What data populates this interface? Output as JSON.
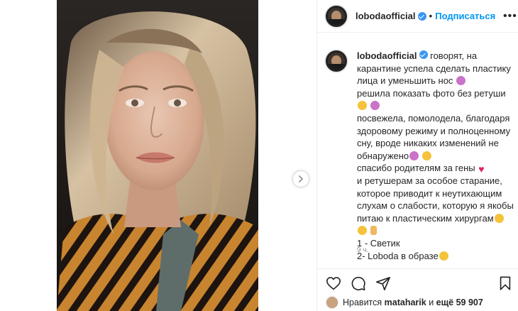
{
  "header": {
    "username": "lobodaofficial",
    "separator": "•",
    "follow_label": "Подписаться",
    "more_label": "•••"
  },
  "caption": {
    "username": "lobodaofficial",
    "lines": [
      "говорят, на",
      "карантине успела сделать пластику",
      "лица и уменьшить нос",
      "решила показать фото без ретуши",
      "",
      "посвежела, помолодела, благодаря",
      "здоровому режиму и полноценному",
      "сну, вроде никаких изменений не",
      "обнаружено",
      "спасибо родителям за гены",
      "и ретушерам за особое старание,",
      "которое приводит к неутихающим",
      "слухам о слабости, которую я якобы",
      "питаю к пластическим хирургам",
      "",
      "1 - Светик",
      "2- Loboda в образе"
    ],
    "timestamp": "9 ч."
  },
  "icons": {
    "verified": "verified-badge-icon",
    "more": "more-options-icon",
    "next": "chevron-right-icon",
    "like": "heart-icon",
    "comment": "comment-icon",
    "share": "paper-plane-icon",
    "save": "bookmark-icon",
    "emoji_laugh": "grinning-face-icon",
    "emoji_person": "person-gesturing-icon",
    "emoji_heart": "red-heart-icon",
    "emoji_hand": "hand-gesture-icon"
  },
  "likes": {
    "prefix": "Нравится",
    "user": "mataharik",
    "middle": "и",
    "count": "ещё 59 907"
  },
  "colors": {
    "accent": "#0095f6",
    "verified": "#3897f0",
    "heart": "#e0245e",
    "text": "#262626",
    "muted": "#8e8e8e",
    "border": "#efefef"
  }
}
